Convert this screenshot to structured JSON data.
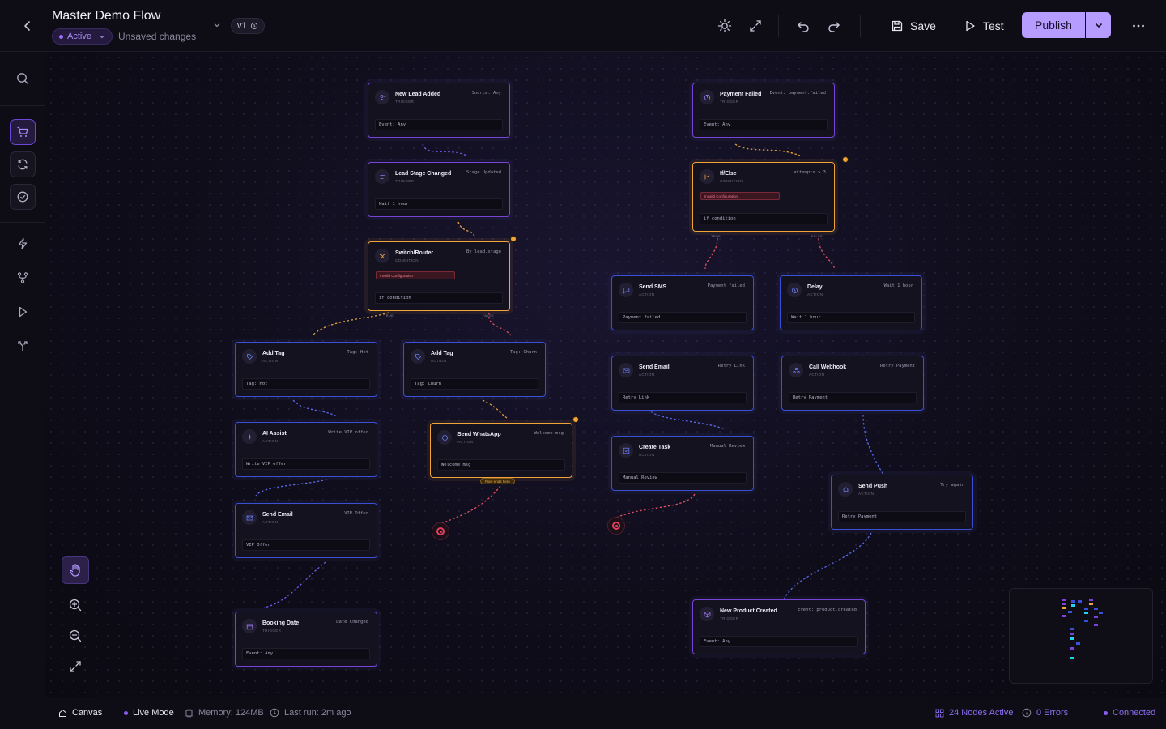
{
  "header": {
    "title": "Master Demo Flow",
    "status": "Active",
    "unsaved": "Unsaved changes",
    "version": "v1",
    "save_label": "Save",
    "test_label": "Test",
    "publish_label": "Publish"
  },
  "nodes": [
    {
      "title": "New Lead Added",
      "type": "TRIGGER",
      "meta": "Source: Any",
      "field": "Event: Any"
    },
    {
      "title": "Lead Stage Changed",
      "type": "TRIGGER",
      "meta": "Stage Updated",
      "field": "Wait 1 hour"
    },
    {
      "title": "Switch/Router",
      "type": "CONDITION",
      "meta": "By lead.stage",
      "badge": "Invalid Configuration",
      "field": "if condition"
    },
    {
      "title": "Add Tag",
      "type": "ACTION",
      "meta": "Tag: Hot",
      "field": "Tag: Hot"
    },
    {
      "title": "Add Tag",
      "type": "ACTION",
      "meta": "Tag: Churn",
      "field": "Tag: Churn"
    },
    {
      "title": "AI Assist",
      "type": "ACTION",
      "meta": "Write VIP offer",
      "field": "Write VIP offer"
    },
    {
      "title": "Send WhatsApp",
      "type": "ACTION",
      "meta": "Welcome msg",
      "field": "Welcome msg"
    },
    {
      "title": "Send Email",
      "type": "ACTION",
      "meta": "VIP Offer",
      "field": "VIP Offer"
    },
    {
      "title": "Booking Date",
      "type": "TRIGGER",
      "meta": "Date Changed",
      "field": "Event: Any"
    },
    {
      "title": "Payment Failed",
      "type": "TRIGGER",
      "meta": "Event: payment.failed",
      "field": "Event: Any"
    },
    {
      "title": "If/Else",
      "type": "CONDITION",
      "meta": "attempts > 3",
      "badge": "Invalid Configuration",
      "field": "if condition"
    },
    {
      "title": "Send SMS",
      "type": "ACTION",
      "meta": "Payment failed",
      "field": "Payment failed"
    },
    {
      "title": "Delay",
      "type": "ACTION",
      "meta": "Wait 1 hour",
      "field": "Wait 1 hour"
    },
    {
      "title": "Send Email",
      "type": "ACTION",
      "meta": "Retry Link",
      "field": "Retry Link"
    },
    {
      "title": "Call Webhook",
      "type": "ACTION",
      "meta": "Retry Payment",
      "field": "Retry Payment"
    },
    {
      "title": "Create Task",
      "type": "ACTION",
      "meta": "Manual Review",
      "field": "Manual Review"
    },
    {
      "title": "Send Push",
      "type": "ACTION",
      "meta": "Try again",
      "field": "Retry Payment"
    },
    {
      "title": "New Product Created",
      "type": "TRIGGER",
      "meta": "Event: product.created",
      "field": "Event: Any"
    }
  ],
  "branch_labels": {
    "true": "TRUE",
    "false": "FALSE"
  },
  "flow_end_label": "Flow ends here",
  "footer": {
    "canvas": "Canvas",
    "live_mode": "Live Mode",
    "memory": "Memory: 124MB",
    "last_run": "Last run: 2m ago",
    "nodes_active": "24 Nodes Active",
    "errors": "0 Errors",
    "connection": "Connected"
  },
  "colors": {
    "accent": "#b79cff",
    "trigger_border": "#7a43d8",
    "action_border": "#3b50d8",
    "warning": "#f0a43a",
    "error": "#e04060"
  }
}
